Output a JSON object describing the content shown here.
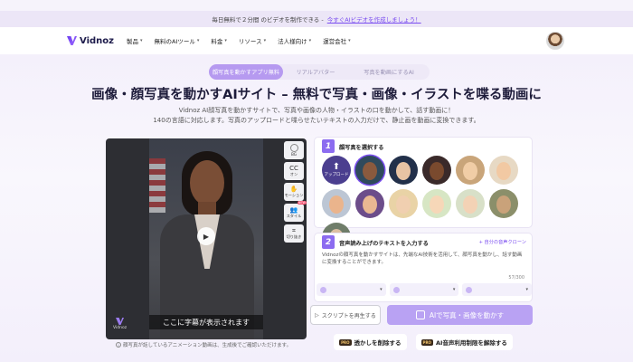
{
  "promo": {
    "text": "毎日無料で２分間 のビデオを制作できる -",
    "link": "今すぐAIビデオを作成しましょう！"
  },
  "nav": {
    "logo": "Vidnoz",
    "items": [
      {
        "label": "製品"
      },
      {
        "label": "無料のAIツール"
      },
      {
        "label": "料金"
      },
      {
        "label": "リソース"
      },
      {
        "label": "法人様向け"
      },
      {
        "label": "運営会社"
      }
    ]
  },
  "tabs": [
    {
      "label": "顔写真を動かすアプリ無料",
      "active": true
    },
    {
      "label": "リアルアバター",
      "active": false
    },
    {
      "label": "写真を動画にするAI",
      "active": false
    }
  ],
  "headline": "画像・顔写真を動かすAIサイト – 無料で写真・画像・イラストを喋る動画に",
  "sub": {
    "line1": "Vidnoz AI顔写真を動かすサイトで、写真や画像の人物・イラストの口を動かして、話す動画に！",
    "line2": "140の言語に対応します。写真のアップロードと喋らせたいテキストの入力だけで、静止画を動画に変換できます。"
  },
  "player": {
    "subtitle": "ここに字幕が表示されます",
    "watermark": "Vidnoz",
    "tools": [
      {
        "label": "BG",
        "icon": "circle-icon"
      },
      {
        "label": "オン",
        "icon": "cc-icon",
        "glyph": "CC"
      },
      {
        "label": "モーション",
        "icon": "motion-icon",
        "glyph": "✋"
      },
      {
        "label": "スタイル",
        "icon": "style-icon",
        "glyph": "👥",
        "badge": "NEW"
      },
      {
        "label": "切り抜き",
        "icon": "crop-icon",
        "glyph": "⌗"
      }
    ]
  },
  "note": "顔写真が話しているアニメーション動画は、生成後でご確認いただけます。",
  "step1": {
    "num": "1",
    "title": "顔写真を選択する",
    "upload_label": "アップロード",
    "faces": [
      {
        "skin": "#8a5a3e",
        "bg": "#2f4a5c"
      },
      {
        "skin": "#e8c4a4",
        "bg": "#22304a"
      },
      {
        "skin": "#7a4a2e",
        "bg": "#3a2a2a"
      },
      {
        "skin": "#f1cda6",
        "bg": "#c9a57a"
      },
      {
        "skin": "#f2c9a3",
        "bg": "#e7d9c4"
      },
      {
        "skin": "#eab48c",
        "bg": "#bcc6d4"
      },
      {
        "skin": "#e9b892",
        "bg": "#6c4d8a"
      },
      {
        "skin": "#f0cfb0",
        "bg": "#e9d3a6"
      },
      {
        "skin": "#f6d7b8",
        "bg": "#d7e6c4"
      },
      {
        "skin": "#f3d2b5",
        "bg": "#d8e0c8"
      },
      {
        "skin": "#c9a27a",
        "bg": "#8b8f6a"
      },
      {
        "skin": "#dcbfa2",
        "bg": "#6f7d69"
      }
    ]
  },
  "step2": {
    "num": "2",
    "title": "音声読み上げのテキストを入力する",
    "clone_link": "+ 自分の音声クローン",
    "text": "Vidnozの顔写真を動かすサイトは、先端なAI技術を活用して、顔写真を動かし、話す動画に変換することができます。",
    "counter": "57/300"
  },
  "buttons": {
    "preview": "スクリプトを再生する",
    "animate": "AIで写真・画像を動かす"
  },
  "pro": [
    {
      "badge": "PRO",
      "label": "透かしを削除する"
    },
    {
      "badge": "PRO",
      "label": "AI音声利用制限を解除する"
    }
  ],
  "colors": {
    "accent": "#7b4ef0",
    "animate_button": "#b9a2f3",
    "active_tab": "#b69af0"
  }
}
